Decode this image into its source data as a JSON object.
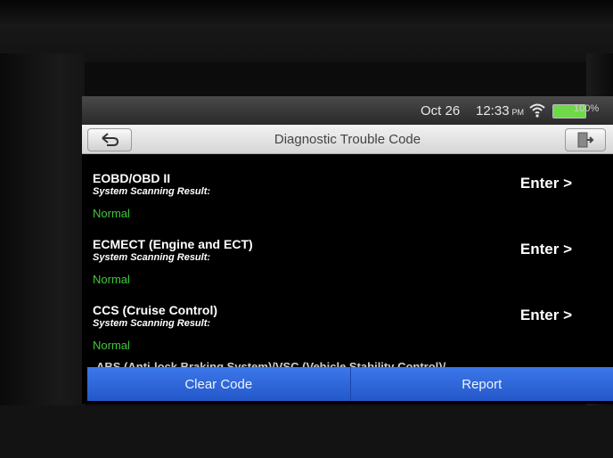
{
  "status_bar": {
    "date": "Oct 26",
    "time": "12:33",
    "ampm": "PM",
    "battery": "100%",
    "icons": [
      "wifi-icon",
      "battery-icon"
    ]
  },
  "header": {
    "title": "Diagnostic Trouble Code",
    "icons": [
      "back-arrow-icon",
      "exit-icon"
    ]
  },
  "list": {
    "items": [
      {
        "title": "EOBD/OBD II",
        "subtitle": "System Scanning Result:",
        "status": "Normal",
        "action": "Enter >"
      },
      {
        "title": "ECMECT (Engine and ECT)",
        "subtitle": "System Scanning Result:",
        "status": "Normal",
        "action": "Enter >"
      },
      {
        "title": "CCS (Cruise Control)",
        "subtitle": "System Scanning Result:",
        "status": "Normal",
        "action": "Enter >"
      }
    ],
    "partial_item": "ABS (Anti-lock Braking System)/VSC (Vehicle Stability Control)/"
  },
  "footer": {
    "clear_code": "Clear Code",
    "report": "Report"
  },
  "colors": {
    "accent_blue": "#2f6be0",
    "status_green": "#3fc83a",
    "battery_green": "#6fd94a"
  }
}
